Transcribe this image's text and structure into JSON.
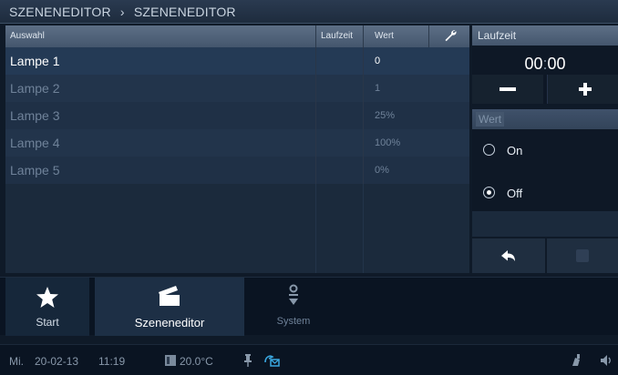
{
  "breadcrumb": {
    "parent": "SZENENEDITOR",
    "separator": "›",
    "current": "SZENENEDITOR"
  },
  "table": {
    "columns": {
      "auswahl": "Auswahl",
      "laufzeit": "Laufzeit",
      "wert": "Wert"
    },
    "rows": [
      {
        "name": "Lampe 1",
        "laufzeit": "",
        "wert": "0"
      },
      {
        "name": "Lampe 2",
        "laufzeit": "",
        "wert": "1"
      },
      {
        "name": "Lampe 3",
        "laufzeit": "",
        "wert": "25%"
      },
      {
        "name": "Lampe 4",
        "laufzeit": "",
        "wert": "100%"
      },
      {
        "name": "Lampe 5",
        "laufzeit": "",
        "wert": "0%"
      }
    ]
  },
  "laufzeit_panel": {
    "header": "Laufzeit",
    "minutes": "00",
    "colon": ":",
    "seconds": "00"
  },
  "wert_panel": {
    "header": "Wert",
    "options": [
      {
        "label": "On",
        "selected": false
      },
      {
        "label": "Off",
        "selected": true
      }
    ]
  },
  "nav": {
    "start": "Start",
    "szeneneditor": "Szeneneditor",
    "system": "System"
  },
  "status": {
    "day": "Mi.",
    "date": "20-02-13",
    "time": "11:19",
    "temperature": "20.0°C"
  },
  "colors": {
    "accent_header": "#4d6079",
    "active_row": "#243a55",
    "tele_icon": "#3aa7e0"
  }
}
